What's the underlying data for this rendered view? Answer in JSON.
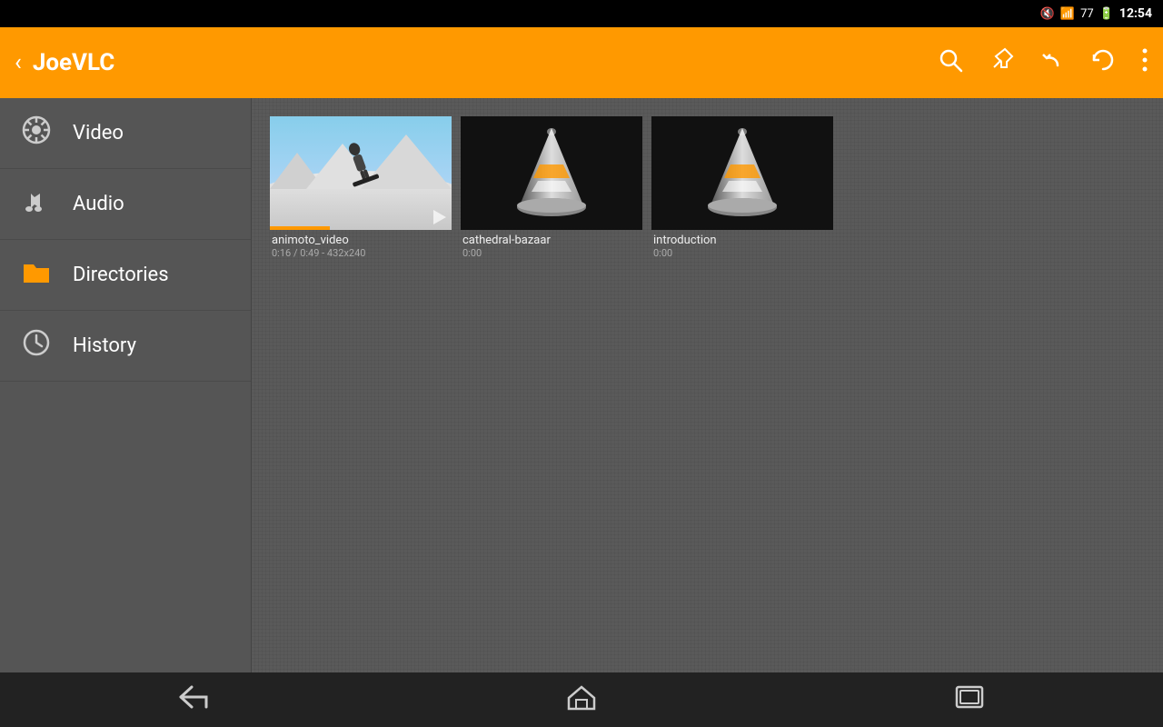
{
  "statusBar": {
    "time": "12:54",
    "batteryLevel": "77"
  },
  "toolbar": {
    "backLabel": "‹",
    "title": "JoeVLC",
    "searchLabel": "🔍",
    "pinLabel": "📌",
    "backwardLabel": "↩",
    "refreshLabel": "🔄",
    "moreLabel": "⋮"
  },
  "sidebar": {
    "items": [
      {
        "id": "video",
        "label": "Video",
        "icon": "video"
      },
      {
        "id": "audio",
        "label": "Audio",
        "icon": "audio"
      },
      {
        "id": "directories",
        "label": "Directories",
        "icon": "directories"
      },
      {
        "id": "history",
        "label": "History",
        "icon": "history"
      }
    ]
  },
  "content": {
    "mediaItems": [
      {
        "id": "animoto_video",
        "title": "animoto_video",
        "meta": "0:16 / 0:49 - 432x240",
        "type": "video"
      },
      {
        "id": "cathedral-bazaar",
        "title": "cathedral-bazaar",
        "meta": "0:00",
        "type": "vlc"
      },
      {
        "id": "introduction",
        "title": "introduction",
        "meta": "0:00",
        "type": "vlc"
      }
    ]
  },
  "navBar": {
    "backLabel": "⬅",
    "homeLabel": "⌂",
    "recentLabel": "▭"
  }
}
